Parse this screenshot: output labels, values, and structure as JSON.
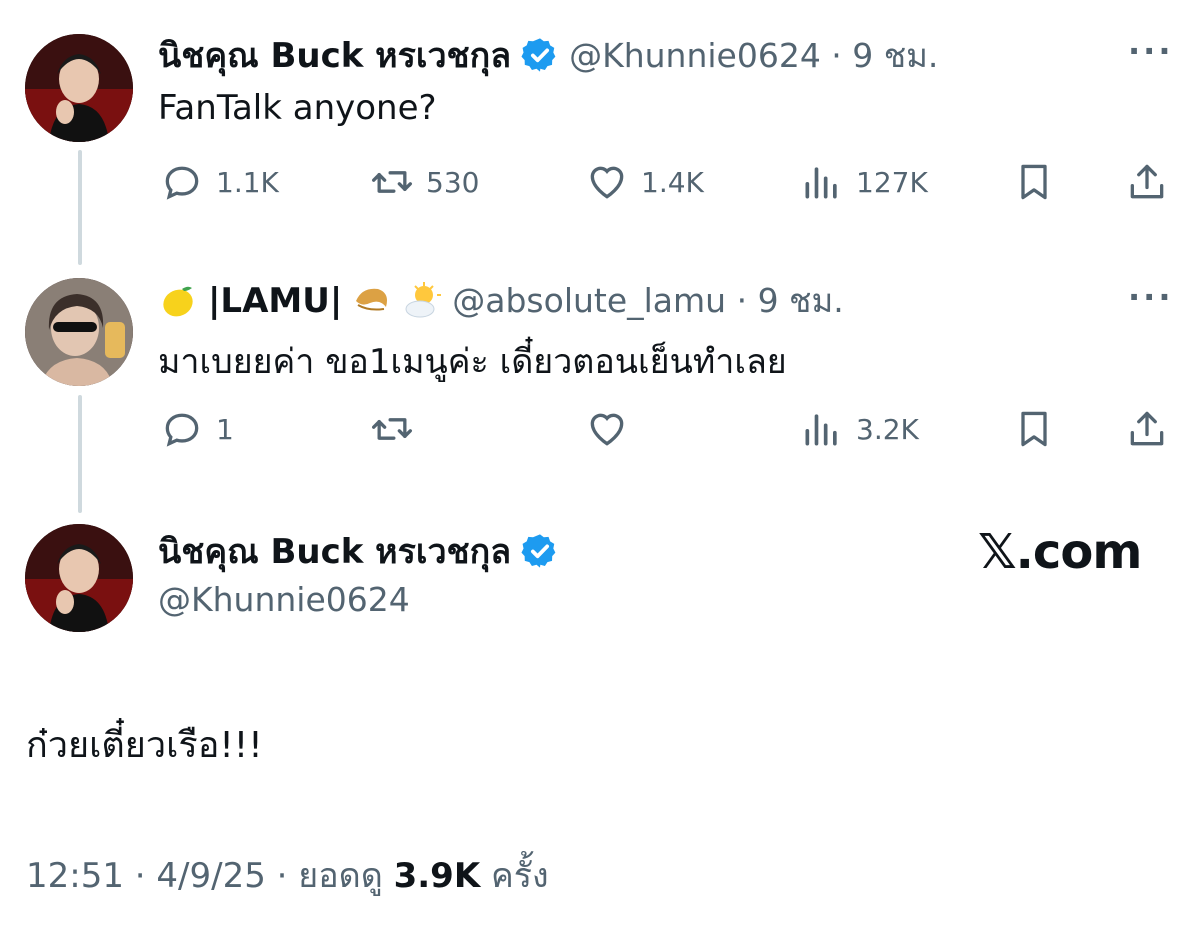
{
  "tweet1": {
    "display_name": "นิชคุณ Buck หรเวชกุล",
    "handle_time": "@Khunnie0624 · 9 ชม.",
    "text": "FanTalk anyone?",
    "reply_count": "1.1K",
    "retweet_count": "530",
    "like_count": "1.4K",
    "view_count": "127K"
  },
  "tweet2": {
    "display_name": "|LAMU|",
    "handle_time": "@absolute_lamu · 9 ชม.",
    "text": "มาเบยยค่า ขอ1เมนูค่ะ เดี๋ยวตอนเย็นทำเลย",
    "reply_count": "1",
    "retweet_count": "",
    "like_count": "",
    "view_count": "3.2K"
  },
  "main_tweet": {
    "display_name": "นิชคุณ Buck หรเวชกุล",
    "handle": "@Khunnie0624",
    "text": "ก๋วยเตี๋ยวเรือ!!!",
    "time_date": "12:51 · 4/9/25 · ยอดดู",
    "views": "3.9K",
    "views_suffix": "ครั้ง"
  },
  "watermark": "𝕏.com",
  "more_label": "···",
  "colors": {
    "verified": "#1d9bf0",
    "muted": "#536471",
    "text": "#0f1419",
    "thread": "#cfd9de"
  },
  "icons": [
    "reply-icon",
    "retweet-icon",
    "like-icon",
    "views-icon",
    "bookmark-icon",
    "share-icon",
    "verified-badge-icon",
    "more-icon",
    "lemon-emoji",
    "fortune-cookie-emoji",
    "sun-cloud-emoji"
  ]
}
